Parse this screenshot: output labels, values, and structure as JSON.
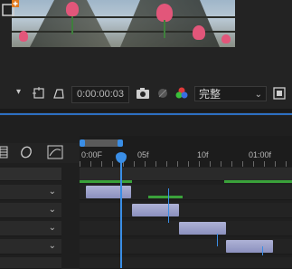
{
  "toolbar": {
    "timecode": "0:00:00:03",
    "quality": "完整"
  },
  "ruler": {
    "labels": [
      "0:00F",
      "05f",
      "10f",
      "01:00f"
    ]
  },
  "layers": [
    {
      "name": ""
    },
    {
      "name": ""
    },
    {
      "name": ""
    },
    {
      "name": ""
    },
    {
      "name": ""
    }
  ],
  "icons": {
    "add": "add-to-composition-icon",
    "snapshot": "camera-icon",
    "color": "color-channel-icon"
  },
  "colors": {
    "accent": "#3a8ee6",
    "clip": "#9ea2cc",
    "green": "#3aa13a"
  }
}
